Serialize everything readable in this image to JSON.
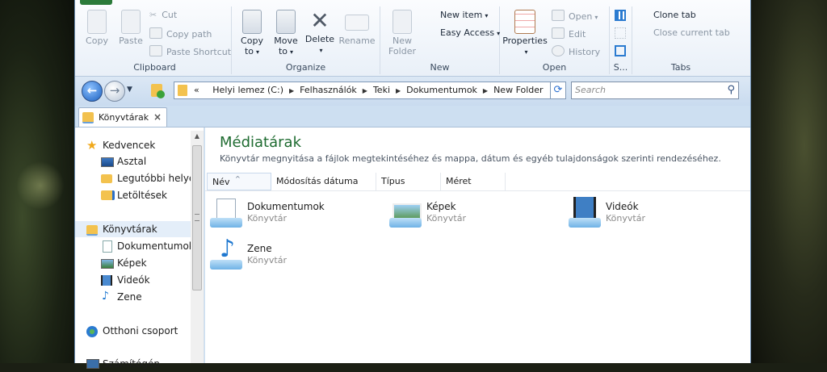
{
  "ribbon": {
    "clipboard": {
      "label": "Clipboard",
      "copy": "Copy",
      "paste": "Paste",
      "cut": "Cut",
      "copy_path": "Copy path",
      "paste_shortcut": "Paste Shortcut"
    },
    "organize": {
      "label": "Organize",
      "copy_to": "Copy",
      "copy_to_sub": "to",
      "move_to": "Move",
      "move_to_sub": "to",
      "delete": "Delete",
      "rename": "Rename"
    },
    "new": {
      "label": "New",
      "new_folder_line1": "New",
      "new_folder_line2": "Folder",
      "new_item": "New item",
      "easy_access": "Easy Access"
    },
    "open": {
      "label": "Open",
      "properties": "Properties",
      "open": "Open",
      "edit": "Edit",
      "history": "History"
    },
    "select": {
      "label": "S..."
    },
    "tabs": {
      "label": "Tabs",
      "clone_tab": "Clone tab",
      "close_current_tab": "Close current tab"
    }
  },
  "address": {
    "prefix": "«",
    "crumbs": [
      "Helyi lemez (C:)",
      "Felhasználók",
      "Teki",
      "Dokumentumok",
      "New Folder"
    ]
  },
  "search": {
    "placeholder": "Search"
  },
  "tab": {
    "label": "Könyvtárak",
    "close": "×"
  },
  "nav": {
    "favorites": "Kedvencek",
    "desktop": "Asztal",
    "recent": "Legutóbbi helyek",
    "downloads": "Letöltések",
    "libraries": "Könyvtárak",
    "documents": "Dokumentumok",
    "pictures": "Képek",
    "videos": "Videók",
    "music": "Zene",
    "homegroup": "Otthoni csoport",
    "computer": "Számítógép"
  },
  "content": {
    "title": "Médiatárak",
    "subtitle": "Könyvtár megnyitása a fájlok megtekintéséhez és mappa, dátum és egyéb tulajdonságok szerinti rendezéséhez.",
    "columns": [
      "Név",
      "Módosítás dátuma",
      "Típus",
      "Méret"
    ],
    "libraries": [
      {
        "name": "Dokumentumok",
        "type": "Könyvtár",
        "icon": "documents-library-icon"
      },
      {
        "name": "Képek",
        "type": "Könyvtár",
        "icon": "pictures-library-icon"
      },
      {
        "name": "Videók",
        "type": "Könyvtár",
        "icon": "videos-library-icon"
      },
      {
        "name": "Zene",
        "type": "Könyvtár",
        "icon": "music-library-icon"
      }
    ]
  },
  "colors": {
    "title_green": "#1e6b30",
    "ribbon_bg": "#e9f0f8",
    "selected": "#e4eef9"
  }
}
